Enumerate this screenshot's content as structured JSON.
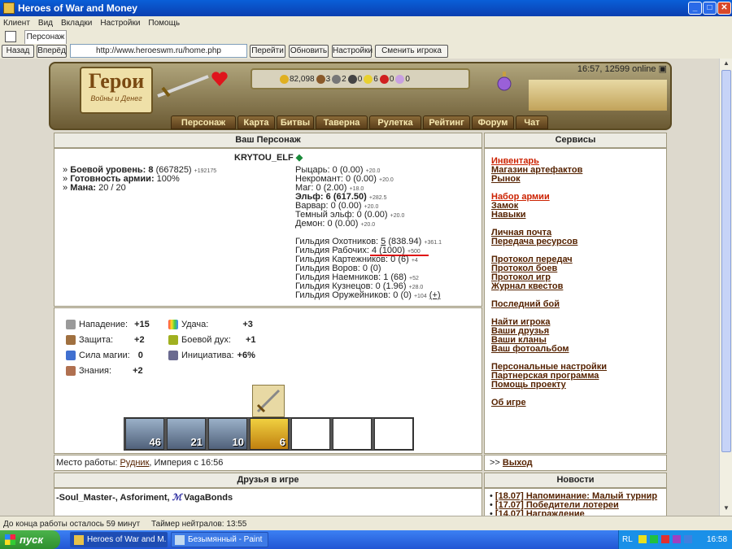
{
  "window": {
    "title": "Heroes of War and Money"
  },
  "menu": [
    "Клиент",
    "Вид",
    "Вкладки",
    "Настройки",
    "Помощь"
  ],
  "tab": {
    "label": "Персонаж"
  },
  "nav": {
    "back": "Назад",
    "forward": "Вперёд",
    "url": "http://www.heroeswm.ru/home.php",
    "go": "Перейти",
    "refresh": "Обновить",
    "settings": "Настройки",
    "change_player": "Сменить игрока"
  },
  "header": {
    "logo_title": "Герои",
    "logo_subtitle": "Войны и Денег",
    "clock": "16:57, 12599 online",
    "resources": [
      {
        "icon": "gold-icon",
        "value": "82,098",
        "color": "#e0b020"
      },
      {
        "icon": "wood-icon",
        "value": "3",
        "color": "#8a5a2a"
      },
      {
        "icon": "ore-icon",
        "value": "2",
        "color": "#777777"
      },
      {
        "icon": "mercury-icon",
        "value": "0",
        "color": "#444444"
      },
      {
        "icon": "sulfur-icon",
        "value": "6",
        "color": "#e8d030"
      },
      {
        "icon": "crystal-icon",
        "value": "0",
        "color": "#d02020"
      },
      {
        "icon": "gem-icon",
        "value": "0",
        "color": "#c8a0e0"
      }
    ],
    "nav": [
      "Персонаж",
      "Карта",
      "Битвы",
      "Таверна",
      "Рулетка",
      "Рейтинг",
      "Форум",
      "Чат"
    ]
  },
  "character": {
    "heading": "Ваш Персонаж",
    "name": "KRYTOU_ELF",
    "combat_label": "Боевой уровень:",
    "combat_level": "8",
    "combat_exp": "(667825)",
    "combat_next": "+192175",
    "army_label": "Готовность армии:",
    "army_value": "100%",
    "mana_label": "Мана:",
    "mana_value": "20 / 20",
    "factions": [
      {
        "label": "Рыцарь:",
        "value": "0 (0.00)",
        "extra": "+20.0"
      },
      {
        "label": "Некромант:",
        "value": "0 (0.00)",
        "extra": "+20.0"
      },
      {
        "label": "Маг:",
        "value": "0 (2.00)",
        "extra": "+18.0"
      },
      {
        "label": "Эльф:",
        "value": "6 (617.50)",
        "extra": "+282.5",
        "bold": true
      },
      {
        "label": "Варвар:",
        "value": "0 (0.00)",
        "extra": "+20.0"
      },
      {
        "label": "Темный эльф:",
        "value": "0 (0.00)",
        "extra": "+20.0"
      },
      {
        "label": "Демон:",
        "value": "0 (0.00)",
        "extra": "+20.0"
      }
    ],
    "guilds": [
      {
        "label": "Гильдия Охотников:",
        "level": "5",
        "value": "(838.94)",
        "extra": "+361.1"
      },
      {
        "label": "Гильдия Рабочих:",
        "level": "4",
        "value": "(1000)",
        "extra": "+500"
      },
      {
        "label": "Гильдия Картежников:",
        "level": "0",
        "value": "(6)",
        "extra": "+4"
      },
      {
        "label": "Гильдия Воров:",
        "level": "0",
        "value": "(0)",
        "extra": ""
      },
      {
        "label": "Гильдия Наемников:",
        "level": "1",
        "value": "(68)",
        "extra": "+52"
      },
      {
        "label": "Гильдия Кузнецов:",
        "level": "0",
        "value": "(1.96)",
        "extra": "+28.0"
      },
      {
        "label": "Гильдия Оружейников:",
        "level": "0",
        "value": "(0)",
        "extra": "+104"
      }
    ],
    "plus_link": "(+)"
  },
  "stats": {
    "attack_label": "Нападение:",
    "attack": "+15",
    "luck_label": "Удача:",
    "luck": "+3",
    "defense_label": "Защита:",
    "defense": "+2",
    "morale_label": "Боевой дух:",
    "morale": "+1",
    "spell_label": "Сила магии:",
    "spell": "0",
    "init_label": "Инициатива:",
    "init": "+6%",
    "knowledge_label": "Знания:",
    "knowledge": "+2"
  },
  "army": [
    "46",
    "21",
    "10",
    "6"
  ],
  "work": {
    "label": "Место работы:",
    "link": "Рудник",
    "suffix": ", Империя с 16:56"
  },
  "services": {
    "heading": "Сервисы",
    "items": [
      "Инвентарь",
      "Магазин артефактов",
      "Рынок",
      "Набор армии",
      "Замок",
      "Навыки",
      "Личная почта",
      "Передача ресурсов",
      "Протокол передач",
      "Протокол боев",
      "Протокол игр",
      "Журнал квестов",
      "Последний бой",
      "Найти игрока",
      "Ваши друзья",
      "Ваши кланы",
      "Ваш фотоальбом",
      "Персональные настройки",
      "Партнерская программа",
      "Помощь проекту",
      "Об игре"
    ],
    "exit_prefix": ">> ",
    "exit": "Выход"
  },
  "friends": {
    "heading": "Друзья в игре",
    "list": [
      "-Soul_Master-",
      ", ",
      "Asforiment",
      ", ",
      "VagaBonds"
    ]
  },
  "news": {
    "heading": "Новости",
    "items": [
      "[18.07] Напоминание: Малый турнир",
      "[17.07] Победители лотереи",
      "[14.07] Награждение"
    ]
  },
  "status": {
    "left": "До конца работы осталось 59 минут",
    "timer": "Таймер нейтралов: 13:55"
  },
  "taskbar": {
    "start": "пуск",
    "tasks": [
      "Heroes of War and M...",
      "Безымянный - Paint"
    ],
    "lang": "RL",
    "time": "16:58"
  }
}
